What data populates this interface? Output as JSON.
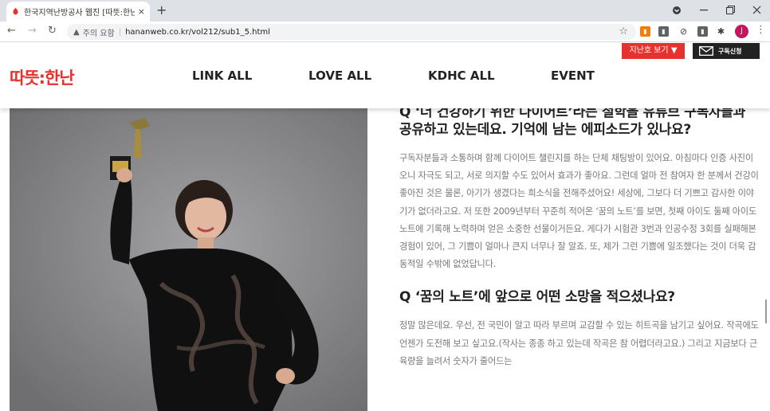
{
  "browser": {
    "tab_title": "한국지역난방공사 웹진 [따뜻:한난",
    "tab_close": "×",
    "new_tab": "+",
    "security_label": "주의 요함",
    "url": "hananweb.co.kr/vol212/sub1_5.html",
    "profile_initial": "J"
  },
  "site": {
    "logo": "따뜻:한난",
    "nav": [
      "LINK ALL",
      "LOVE ALL",
      "KDHC ALL",
      "EVENT"
    ],
    "past_issue_label": "지난호 보기",
    "subscribe_label": "구독신청",
    "brand_color": "#e8312e"
  },
  "article": {
    "q1": "Q ‘더 건강하기 위한 다이어트’라는 철학을 유튜브 구독자들과 공유하고 있는데요. 기억에 남는 에피소드가 있나요?",
    "a1": "구독자분들과 소통하며 함께 다이어트 챌린지를 하는 단체 채팅방이 있어요. 아침마다 인증 사진이 오니 자극도 되고, 서로 의지할 수도 있어서 효과가 좋아요. 그런데 얼마 전 참여자 한 분께서 건강이 좋아진 것은 물론, 아기가 생겼다는 희소식을 전해주셨어요! 세상에, 그보다 더 기쁘고 감사한 이야기가 없더라고요. 저 또한 2009년부터 꾸준히 적어온 ‘꿈의 노트’를 보면, 첫째 아이도 둘째 아이도 노트에 기록해 노력하며 얻은 소중한 선물이거든요. 게다가 시험관 3번과 인공수정 3회를 실패해본 경험이 있어, 그 기쁨이 얼마나 큰지 너무나 잘 알죠. 또, 제가 그런 기쁨에 일조했다는 것이 더욱 감동적일 수밖에 없었답니다.",
    "q2": "Q ‘꿈의 노트’에 앞으로 어떤 소망을 적으셨나요?",
    "a2": "정말 많은데요. 우선, 전 국민이 알고 따라 부르며 교감할 수 있는 히트곡을 남기고 싶어요. 작곡에도 언젠가 도전해 보고 싶고요.(작사는 종종 하고 있는데 작곡은 참 어렵더라고요.) 그리고 지금보다 근육량을 늘려서 숫자가 줄어드는"
  }
}
